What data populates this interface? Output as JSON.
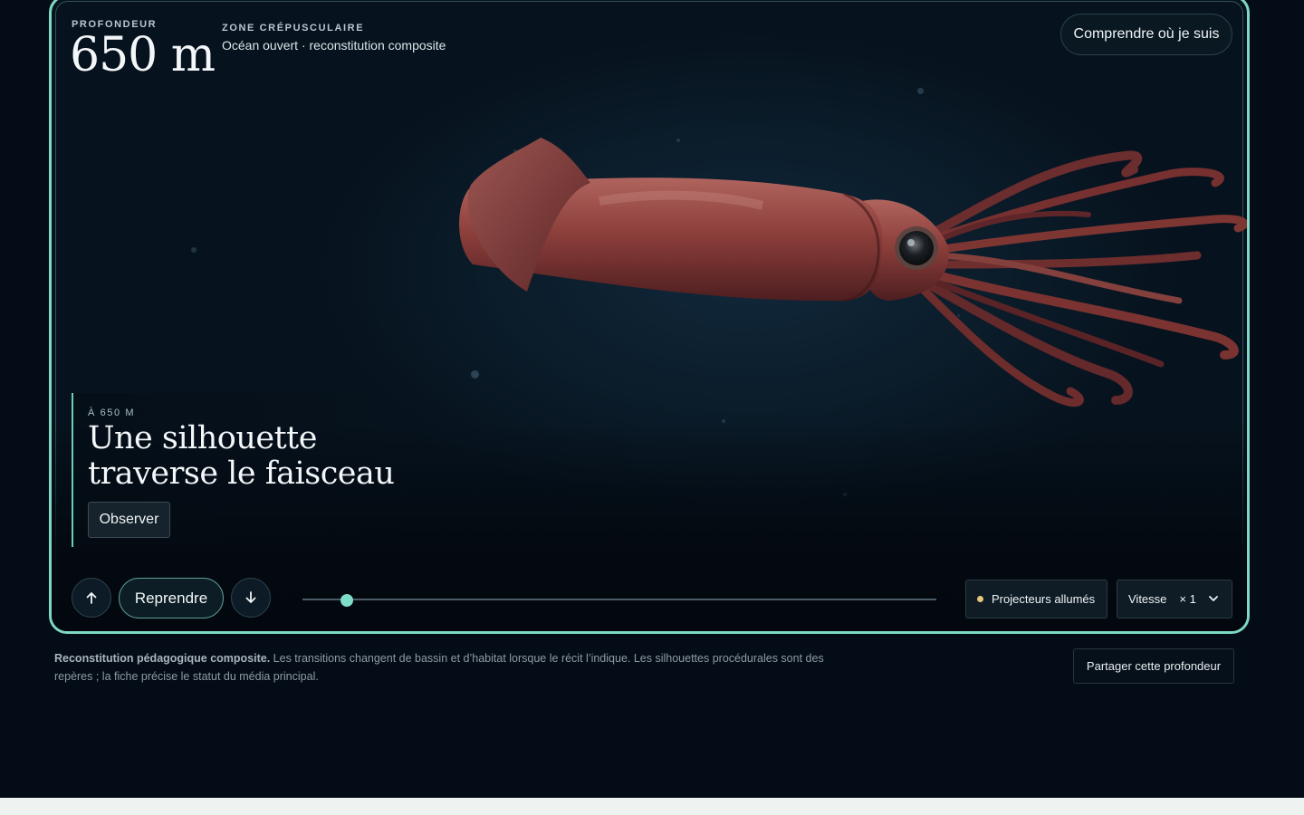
{
  "header": {
    "depth_label": "PROFONDEUR",
    "depth_value": "650 m",
    "zone_name": "ZONE CRÉPUSCULAIRE",
    "zone_subtitle": "Océan ouvert · reconstitution composite",
    "understand_button": "Comprendre où je suis"
  },
  "story": {
    "depth_tag": "À 650 M",
    "title": "Une silhouette traverse le faisceau",
    "observe_button": "Observer"
  },
  "controls": {
    "up_icon": "arrow-up-icon",
    "down_icon": "arrow-down-icon",
    "resume_button": "Reprendre",
    "progress": 0.07,
    "lights_label": "Projecteurs allumés",
    "speed_label": "Vitesse",
    "speed_value": "× 1"
  },
  "footer": {
    "note_bold": "Reconstitution pédagogique composite.",
    "note_text": " Les transitions changent de bassin et d’habitat lorsque le récit l’indique. Les silhouettes procédurales sont des repères ; la fiche précise le statut du média principal.",
    "share_button": "Partager cette profondeur"
  },
  "colors": {
    "accent": "#7fd8c4",
    "background": "#040d17",
    "lights_indicator": "#e8c77a"
  }
}
